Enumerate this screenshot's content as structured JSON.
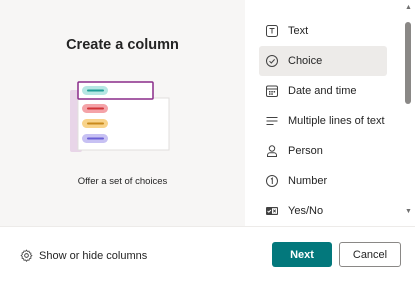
{
  "left_panel": {
    "title": "Create a column",
    "caption": "Offer a set of choices"
  },
  "column_types": [
    {
      "label": "Text",
      "icon": "text-box-icon",
      "selected": false
    },
    {
      "label": "Choice",
      "icon": "check-circle-icon",
      "selected": true
    },
    {
      "label": "Date and time",
      "icon": "calendar-icon",
      "selected": false
    },
    {
      "label": "Multiple lines of text",
      "icon": "multiline-text-icon",
      "selected": false
    },
    {
      "label": "Person",
      "icon": "person-icon",
      "selected": false
    },
    {
      "label": "Number",
      "icon": "number-circle-icon",
      "selected": false
    },
    {
      "label": "Yes/No",
      "icon": "toggle-icon",
      "selected": false
    }
  ],
  "footer": {
    "show_hide_label": "Show or hide columns",
    "next_label": "Next",
    "cancel_label": "Cancel"
  },
  "colors": {
    "accent": "#03787c",
    "selected_bg": "#edebe9",
    "panel_bg": "#f7f6f5",
    "illustration_border": "#8a2c8a",
    "choice_teal": "#5ec9c2",
    "choice_red": "#f4a3a8",
    "choice_yellow": "#f8d38a",
    "choice_purple": "#b9b3f0"
  }
}
